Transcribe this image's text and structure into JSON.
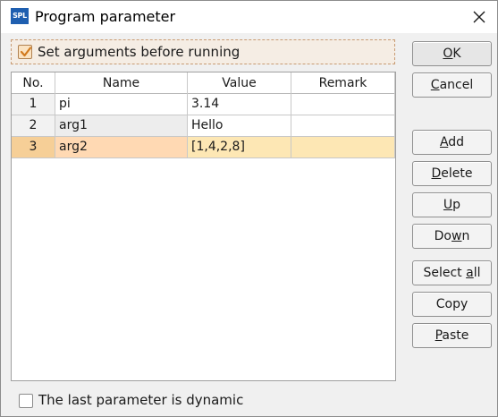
{
  "window": {
    "title": "Program parameter",
    "app_icon_text": "SPL"
  },
  "options": {
    "set_arguments_label": "Set arguments before running",
    "set_arguments_checked": true,
    "dynamic_label": "The last parameter is dynamic",
    "dynamic_checked": false
  },
  "table": {
    "headers": {
      "no": "No.",
      "name": "Name",
      "value": "Value",
      "remark": "Remark"
    },
    "rows": [
      {
        "no": "1",
        "name": "pi",
        "value": "3.14",
        "remark": ""
      },
      {
        "no": "2",
        "name": "arg1",
        "value": "Hello",
        "remark": ""
      },
      {
        "no": "3",
        "name": "arg2",
        "value": "[1,4,2,8]",
        "remark": ""
      }
    ],
    "selected_row": "3"
  },
  "buttons": {
    "ok": {
      "before": "",
      "key": "O",
      "after": "K"
    },
    "cancel": {
      "before": "",
      "key": "C",
      "after": "ancel"
    },
    "add": {
      "before": "",
      "key": "A",
      "after": "dd"
    },
    "delete": {
      "before": "",
      "key": "D",
      "after": "elete"
    },
    "up": {
      "before": "",
      "key": "U",
      "after": "p"
    },
    "down": {
      "before": "Do",
      "key": "w",
      "after": "n"
    },
    "select_all": {
      "before": "Select ",
      "key": "a",
      "after": "ll"
    },
    "copy": {
      "before": "Copy",
      "key": "",
      "after": ""
    },
    "paste": {
      "before": "",
      "key": "P",
      "after": "aste"
    }
  },
  "colors": {
    "selected_row": "#fde7b4",
    "checkbox_check": "#d27a1e",
    "app_icon": "#1f5fb0"
  },
  "icons": {
    "app": "spl-app-icon",
    "close": "close-icon",
    "check": "check-icon"
  }
}
